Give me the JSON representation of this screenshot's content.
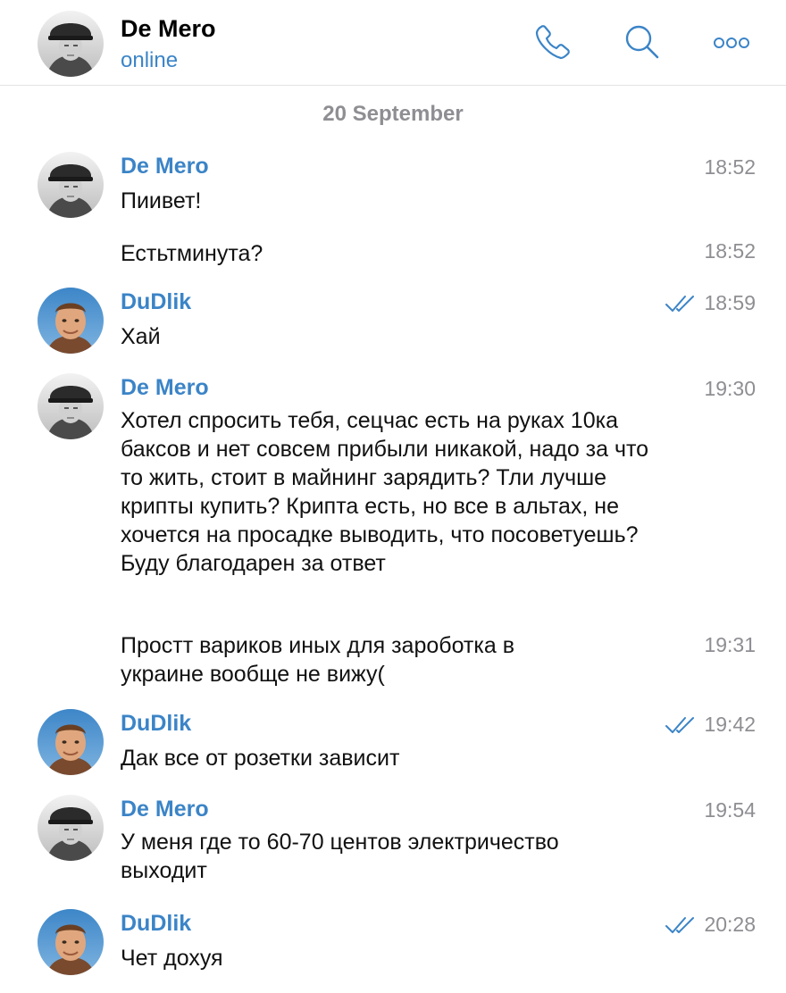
{
  "header": {
    "title": "De Mero",
    "status": "online",
    "icons": [
      "phone-icon",
      "search-icon",
      "more-icon"
    ]
  },
  "date_separator": "20 September",
  "colors": {
    "accent": "#3b84c7",
    "muted": "#8e8e93",
    "divider": "#e3e3e3"
  },
  "messages": [
    {
      "sender": "De Mero",
      "text": "Пиивет!",
      "time": "18:52",
      "read": false
    },
    {
      "sender": "",
      "text": "Естьтминута?",
      "time": "18:52",
      "read": false
    },
    {
      "sender": "DuDlik",
      "text": "Хай",
      "time": "18:59",
      "read": true
    },
    {
      "sender": "De Mero",
      "text": "Хотел спросить тебя, сецчас есть на руках 10ка баксов и нет совсем прибыли никакой, надо за что то жить, стоит в майнинг зарядить? Тли лучше крипты купить? Крипта есть, но все в альтах, не хочется на просадке выводить, что посоветуешь? Буду благодарен за ответ",
      "time": "19:30",
      "read": false
    },
    {
      "sender": "",
      "text": "Простт вариков иных для зароботка в украине вообще не вижу(",
      "time": "19:31",
      "read": false
    },
    {
      "sender": "DuDlik",
      "text": "Дак все от розетки зависит",
      "time": "19:42",
      "read": true
    },
    {
      "sender": "De Mero",
      "text": "У меня где то 60-70 центов электричество выходит",
      "time": "19:54",
      "read": false
    },
    {
      "sender": "DuDlik",
      "text": "Чет дохуя",
      "time": "20:28",
      "read": true
    }
  ]
}
